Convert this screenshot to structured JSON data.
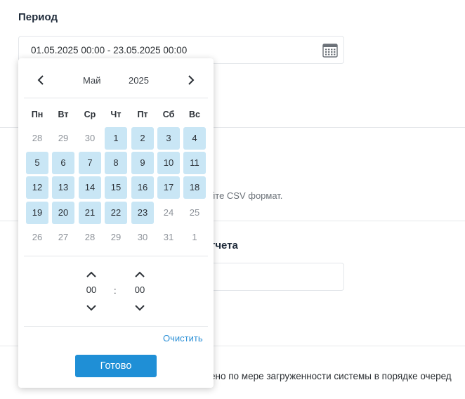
{
  "period": {
    "label": "Период",
    "value": "01.05.2025 00:00 - 23.05.2025 00:00",
    "icon": "calendar-icon"
  },
  "background": {
    "hint_text": "йте CSV формат.",
    "report_label": "тчета",
    "queue_text": "ено по мере загруженности системы в порядке очеред"
  },
  "picker": {
    "month": "Май",
    "year": "2025",
    "prev_icon": "chevron-left-icon",
    "next_icon": "chevron-right-icon",
    "weekdays": [
      "Пн",
      "Вт",
      "Ср",
      "Чт",
      "Пт",
      "Сб",
      "Вс"
    ],
    "weeks": [
      [
        "28",
        "29",
        "30",
        "1",
        "2",
        "3",
        "4"
      ],
      [
        "5",
        "6",
        "7",
        "8",
        "9",
        "10",
        "11"
      ],
      [
        "12",
        "13",
        "14",
        "15",
        "16",
        "17",
        "18"
      ],
      [
        "19",
        "20",
        "21",
        "22",
        "23",
        "24",
        "25"
      ],
      [
        "26",
        "27",
        "28",
        "29",
        "30",
        "31",
        "1"
      ]
    ],
    "selected_range": {
      "start": "1",
      "end": "23"
    },
    "time": {
      "hours": "00",
      "separator": ":",
      "minutes": "00"
    },
    "clear_label": "Очистить",
    "done_label": "Готово"
  },
  "colors": {
    "accent": "#1f8fd6",
    "selected_day_bg": "#c9e6f5",
    "link": "#2a8fd6"
  }
}
